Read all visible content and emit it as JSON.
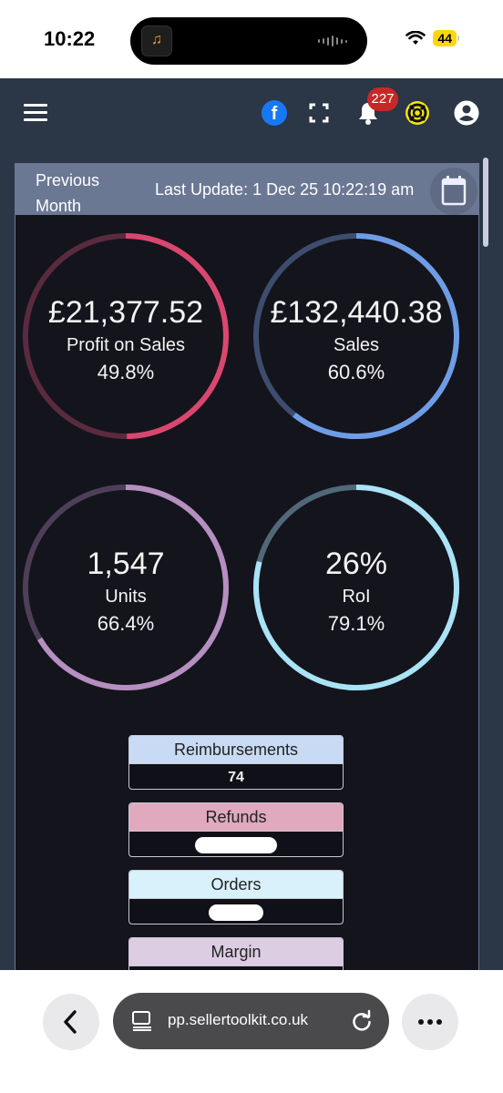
{
  "status": {
    "time": "10:22",
    "battery": "44"
  },
  "header": {
    "notification_count": "227"
  },
  "panel": {
    "period": "Previous Month",
    "period_line1": "Previous",
    "period_line2": "Month",
    "last_update": "Last Update: 1 Dec 25 10:22:19 am"
  },
  "gauges": [
    {
      "value": "£21,377.52",
      "label": "Profit on Sales",
      "percent": "49.8%",
      "fraction": 0.498,
      "color": "#d9476f",
      "track": "#5a2a3e"
    },
    {
      "value": "£132,440.38",
      "label": "Sales",
      "percent": "60.6%",
      "fraction": 0.606,
      "color": "#6f9ce6",
      "track": "#3d4d6e"
    },
    {
      "value": "1,547",
      "label": "Units",
      "percent": "66.4%",
      "fraction": 0.664,
      "color": "#b58fc0",
      "track": "#4e3f58"
    },
    {
      "value": "26%",
      "label": "RoI",
      "percent": "79.1%",
      "fraction": 0.791,
      "color": "#a9e3f5",
      "track": "#506878"
    }
  ],
  "stats": [
    {
      "title": "Reimbursements",
      "value": "74",
      "color": "#c9daf4"
    },
    {
      "title": "Refunds",
      "value": "",
      "color": "#e0a9bd"
    },
    {
      "title": "Orders",
      "value": "",
      "color": "#d8f1fa"
    },
    {
      "title": "Margin",
      "value": "",
      "color": "#dccde3"
    }
  ],
  "browser": {
    "url": "pp.sellertoolkit.co.uk"
  },
  "icons": [
    "hamburger-icon",
    "facebook-icon",
    "fullscreen-icon",
    "bell-icon",
    "help-icon",
    "user-icon",
    "calendar-icon",
    "back-icon",
    "tabs-icon",
    "reload-icon",
    "more-icon"
  ]
}
